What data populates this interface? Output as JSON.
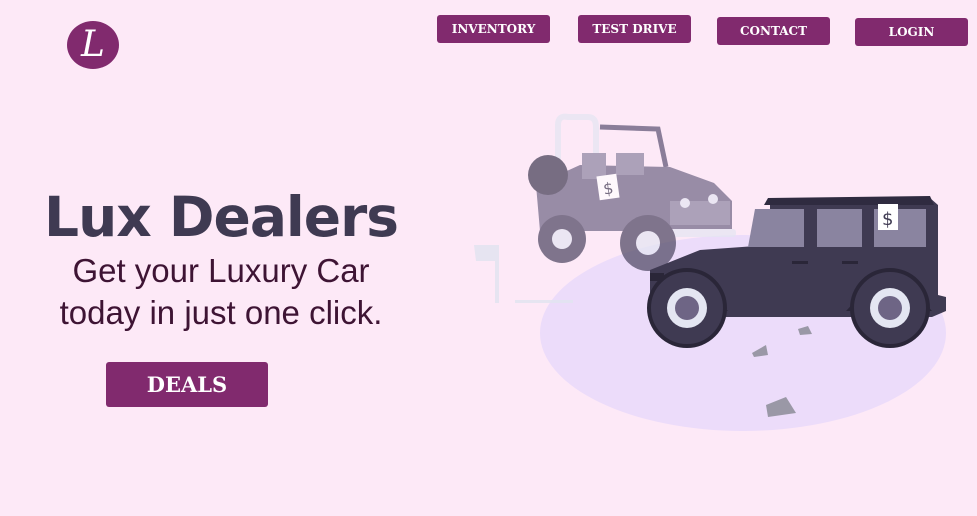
{
  "logo": {
    "letter": "L"
  },
  "nav": {
    "inventory": "INVENTORY",
    "test_drive": "TEST DRIVE",
    "contact": "CONTACT",
    "login": "LOGIN"
  },
  "hero": {
    "title": "Lux Dealers",
    "subtitle_line1": "Get your Luxury Car",
    "subtitle_line2": "today in just one click.",
    "cta": "DEALS"
  },
  "illustration": {
    "price_tag_symbol": "$"
  },
  "colors": {
    "background": "#fde9f7",
    "accent": "#812a6e",
    "title": "#3f3a52",
    "subtitle": "#3e1434",
    "ground": "#ecdcfa",
    "car_dark": "#3f3a52",
    "car_ghost": "#6e6585"
  }
}
